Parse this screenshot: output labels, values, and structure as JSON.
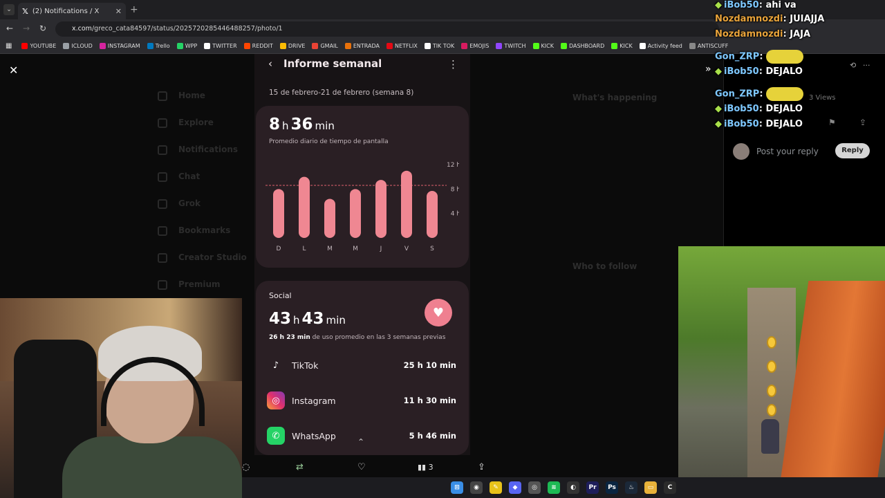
{
  "browser": {
    "tab_title": "(2) Notifications / X",
    "url_prefix": "x.com",
    "url_path": "/greco_cata84597/status/2025720285446488257/photo/1",
    "bookmarks": [
      "YOUTUBE",
      "ICLOUD",
      "INSTAGRAM",
      "Trello",
      "WPP",
      "TWITTER",
      "REDDIT",
      "DRIVE",
      "GMAIL",
      "ENTRADA",
      "NETFLIX",
      "TIK TOK",
      "EMOJIS",
      "TWITCH",
      "KICK",
      "DASHBOARD",
      "KICK",
      "Activity feed",
      "ANTISCUFF"
    ],
    "bookmark_colors": [
      "#ff0000",
      "#9aa0a6",
      "#d6249f",
      "#0079bf",
      "#25d366",
      "#ffffff",
      "#ff4500",
      "#fbbc04",
      "#ea4335",
      "#e8710a",
      "#e50914",
      "#ffffff",
      "#d81b60",
      "#9146ff",
      "#53fc18",
      "#53fc18",
      "#53fc18",
      "#ffffff",
      "#888888"
    ]
  },
  "x_sidebar": [
    "Home",
    "Explore",
    "Notifications",
    "Chat",
    "Grok",
    "Bookmarks",
    "Creator Studio",
    "Premium"
  ],
  "x_right": [
    "What's happening",
    "Who to follow"
  ],
  "phone": {
    "header_title": "Informe semanal",
    "date_range": "15 de febrero-21 de febrero (semana 8)",
    "daily": {
      "hours": "8",
      "h": "h",
      "minutes": "36",
      "min": "min",
      "caption": "Promedio diario de tiempo de pantalla"
    },
    "social": {
      "label": "Social",
      "hours": "43",
      "h": "h",
      "minutes": "43",
      "min": "min",
      "prev_bold": "26 h 23 min",
      "prev_rest": " de uso promedio en las 3 semanas previas",
      "apps": [
        {
          "name": "TikTok",
          "time": "25 h 10 min",
          "icon": "tiktok-icon"
        },
        {
          "name": "Instagram",
          "time": "11 h 30 min",
          "icon": "instagram-icon"
        },
        {
          "name": "WhatsApp",
          "time": "5 h 46 min",
          "icon": "whatsapp-icon"
        }
      ]
    }
  },
  "chart_data": {
    "type": "bar",
    "categories": [
      "D",
      "L",
      "M",
      "M",
      "J",
      "V",
      "S"
    ],
    "values": [
      8,
      10,
      6.4,
      8,
      9.5,
      11,
      7.7
    ],
    "ylim": [
      0,
      12
    ],
    "yticks": [
      "12 h",
      "8 h",
      "4 h"
    ],
    "average_line": 8.6,
    "bar_color": "#ef8792"
  },
  "post_actions": {
    "views_count": "3"
  },
  "right_panel": {
    "views": "3 Views",
    "reply_placeholder": "Post your reply",
    "reply_button": "Reply"
  },
  "chat": [
    {
      "user": "iBob50",
      "text": "ahi va",
      "color": "#7ec8ff",
      "badge": true
    },
    {
      "user": "Nozdamnozdi",
      "text": "JUIAJJA",
      "color": "#e8a33a",
      "badge": false
    },
    {
      "user": "Nozdamnozdi",
      "text": "JAJA",
      "color": "#e8a33a",
      "badge": false
    },
    {
      "user": "Gon_ZRP",
      "text": "",
      "color": "#7ec8ff",
      "badge": false
    },
    {
      "user": "iBob50",
      "text": "DEJALO",
      "color": "#7ec8ff",
      "badge": true
    },
    {
      "user": "Gon_ZRP",
      "text": "",
      "color": "#7ec8ff",
      "badge": false
    },
    {
      "user": "iBob50",
      "text": "DEJALO",
      "color": "#7ec8ff",
      "badge": true
    },
    {
      "user": "iBob50",
      "text": "DEJALO",
      "color": "#7ec8ff",
      "badge": true
    }
  ]
}
